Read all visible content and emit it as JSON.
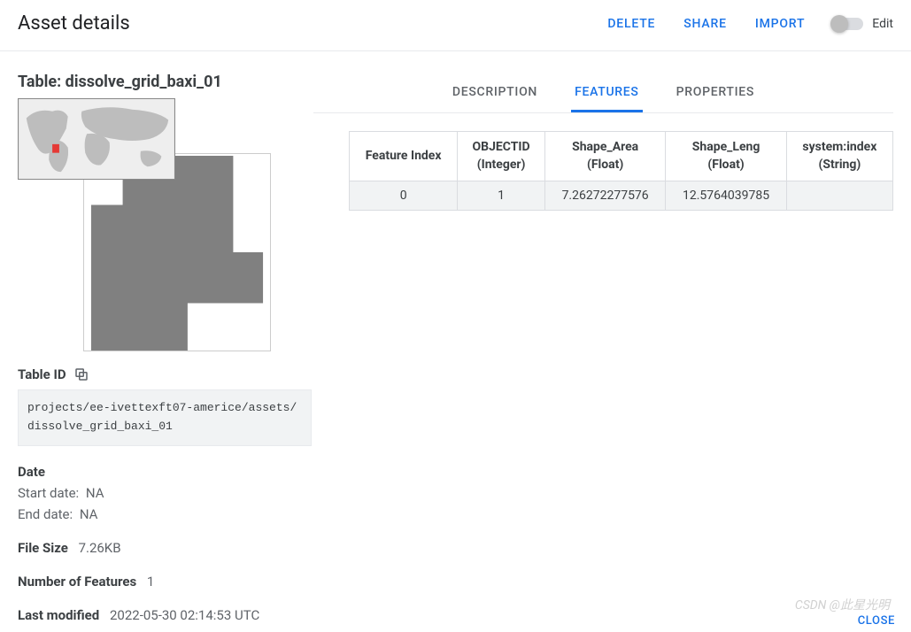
{
  "header": {
    "title": "Asset details",
    "actions": {
      "delete": "DELETE",
      "share": "SHARE",
      "import": "IMPORT"
    },
    "edit_label": "Edit"
  },
  "left": {
    "table_title": "Table: dissolve_grid_baxi_01",
    "table_id_label": "Table ID",
    "table_id_value": "projects/ee-ivettexft07-americe/assets/dissolve_grid_baxi_01",
    "date_label": "Date",
    "start_date_label": "Start date:",
    "start_date_value": "NA",
    "end_date_label": "End date:",
    "end_date_value": "NA",
    "file_size_label": "File Size",
    "file_size_value": "7.26KB",
    "num_features_label": "Number of Features",
    "num_features_value": "1",
    "last_modified_label": "Last modified",
    "last_modified_value": "2022-05-30 02:14:53 UTC"
  },
  "tabs": {
    "description": "DESCRIPTION",
    "features": "FEATURES",
    "properties": "PROPERTIES"
  },
  "features_table": {
    "headers": {
      "idx": "Feature Index",
      "objectid_name": "OBJECTID",
      "objectid_type": "(Integer)",
      "shape_area_name": "Shape_Area",
      "shape_area_type": "(Float)",
      "shape_leng_name": "Shape_Leng",
      "shape_leng_type": "(Float)",
      "sysindex_name": "system:index",
      "sysindex_type": "(String)"
    },
    "row0": {
      "idx": "0",
      "objectid": "1",
      "shape_area": "7.26272277576",
      "shape_leng": "12.5764039785",
      "sysindex": ""
    }
  },
  "footer": {
    "close": "CLOSE"
  },
  "watermark": "CSDN @此星光明"
}
